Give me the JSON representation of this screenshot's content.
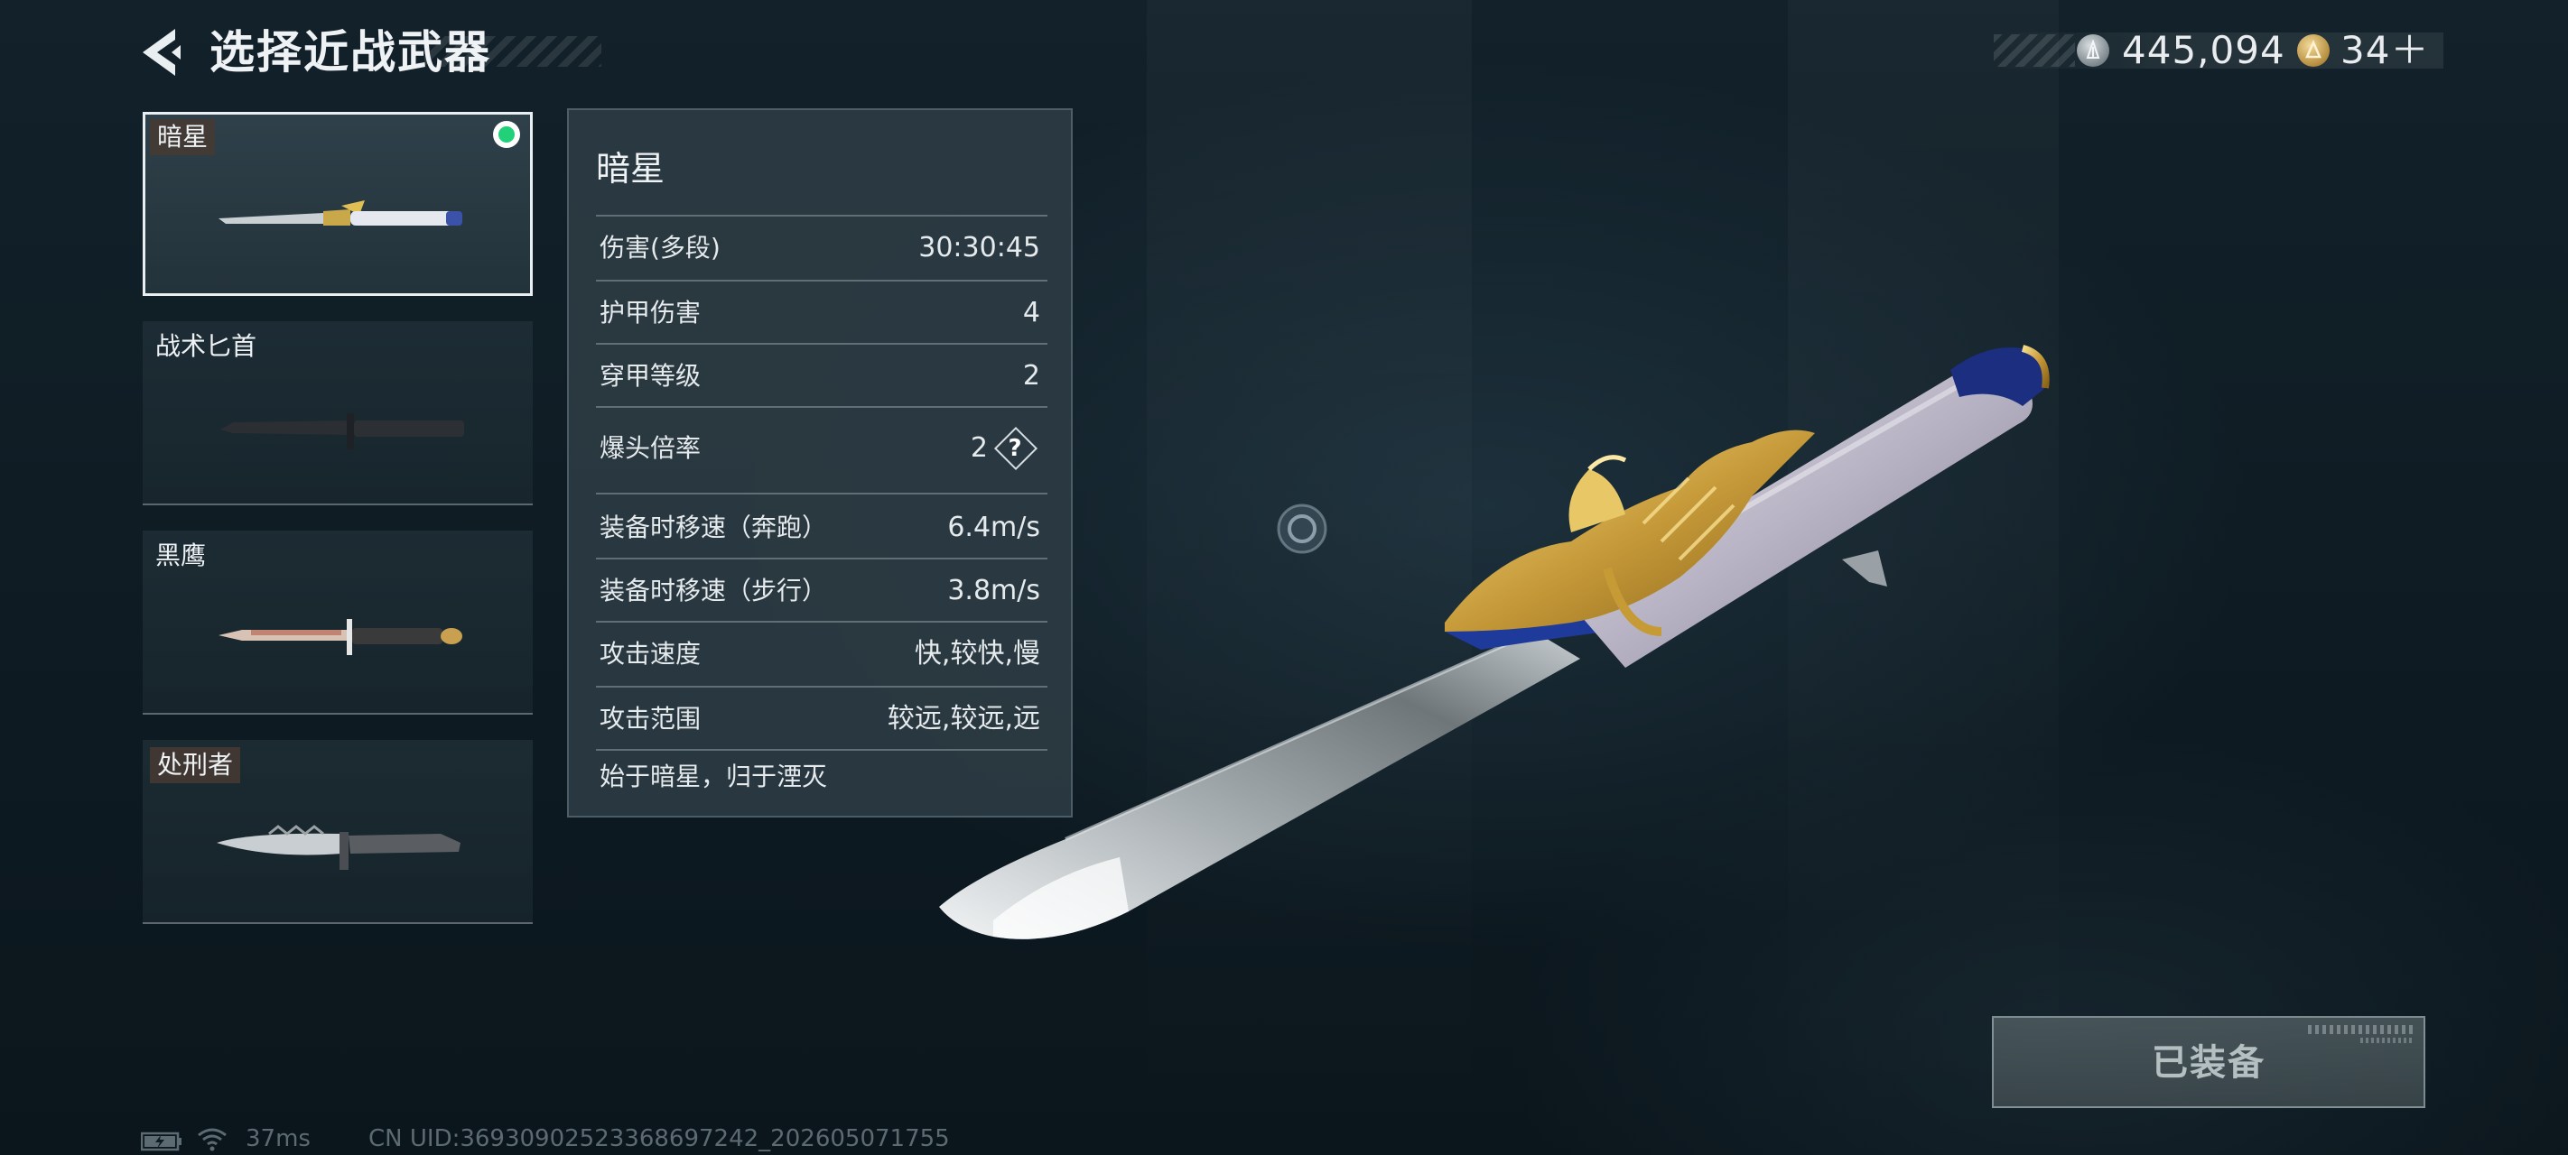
{
  "header": {
    "title": "选择近战武器"
  },
  "currency": {
    "silver_amount": "445,094",
    "gold_amount": "34＋"
  },
  "weapon_list": [
    {
      "name": "暗星",
      "equipped": true,
      "selected": true
    },
    {
      "name": "战术匕首",
      "equipped": false,
      "selected": false
    },
    {
      "name": "黑鹰",
      "equipped": false,
      "selected": false
    },
    {
      "name": "处刑者",
      "equipped": false,
      "selected": false
    }
  ],
  "stats": {
    "weapon_name": "暗星",
    "rows": [
      {
        "label": "伤害(多段)",
        "value": "30:30:45"
      },
      {
        "label": "护甲伤害",
        "value": "4"
      },
      {
        "label": "穿甲等级",
        "value": "2"
      },
      {
        "label": "爆头倍率",
        "value": "2"
      },
      {
        "label": "装备时移速（奔跑）",
        "value": "6.4m/s"
      },
      {
        "label": "装备时移速（步行）",
        "value": "3.8m/s"
      },
      {
        "label": "攻击速度",
        "value": "快,较快,慢"
      },
      {
        "label": "攻击范围",
        "value": "较远,较远,远"
      }
    ],
    "help_symbol": "?",
    "flavor_text": "始于暗星，归于湮灭"
  },
  "equip_button": {
    "label": "已装备"
  },
  "footer": {
    "ping": "37ms",
    "uid": "CN UID:3693090252336869724​2_202605071755"
  },
  "colors": {
    "equipped_indicator": "#22d07a",
    "panel_bg": "#2e3c44",
    "background": "#0f1b22"
  },
  "icons": {
    "back": "chevron-left-icon",
    "silver_coin": "silver-coin-icon",
    "gold_coin": "gold-coin-icon",
    "help": "question-diamond-icon",
    "reticle": "reticle-icon",
    "battery": "battery-charging-icon",
    "wifi": "wifi-icon"
  }
}
